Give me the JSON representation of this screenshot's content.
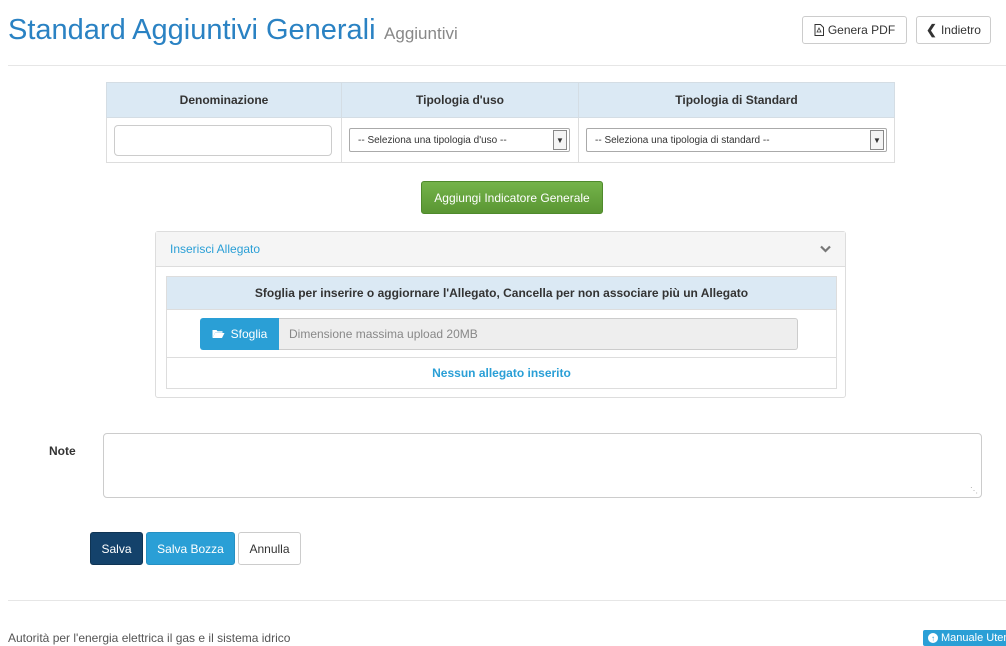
{
  "header": {
    "title": "Standard Aggiuntivi Generali",
    "subtitle": "Aggiuntivi",
    "pdf_button": "Genera PDF",
    "back_button": "Indietro"
  },
  "indicator_table": {
    "columns": [
      "Denominazione",
      "Tipologia d'uso",
      "Tipologia di Standard"
    ],
    "denominazione_value": "",
    "tipologia_uso_selected": "-- Seleziona una tipologia d'uso --",
    "tipologia_standard_selected": "-- Seleziona una tipologia di standard --"
  },
  "add_indicator_button": "Aggiungi Indicatore Generale",
  "attachment_panel": {
    "title": "Inserisci Allegato",
    "instructions": "Sfoglia per inserire o aggiornare l'Allegato, Cancella per non associare più un Allegato",
    "browse_label": "Sfoglia",
    "upload_hint": "Dimensione massima upload 20MB",
    "empty_message": "Nessun allegato inserito"
  },
  "note": {
    "label": "Note",
    "value": ""
  },
  "actions": {
    "save": "Salva",
    "save_draft": "Salva Bozza",
    "cancel": "Annulla"
  },
  "footer": {
    "org_name": "Autorità per l'energia elettrica il gas e il sistema idrico",
    "manual_link": "Manuale Utente"
  },
  "colors": {
    "primary": "#2a9fd6",
    "title": "#2a82c3",
    "success": "#5a9633",
    "save": "#14426b"
  }
}
